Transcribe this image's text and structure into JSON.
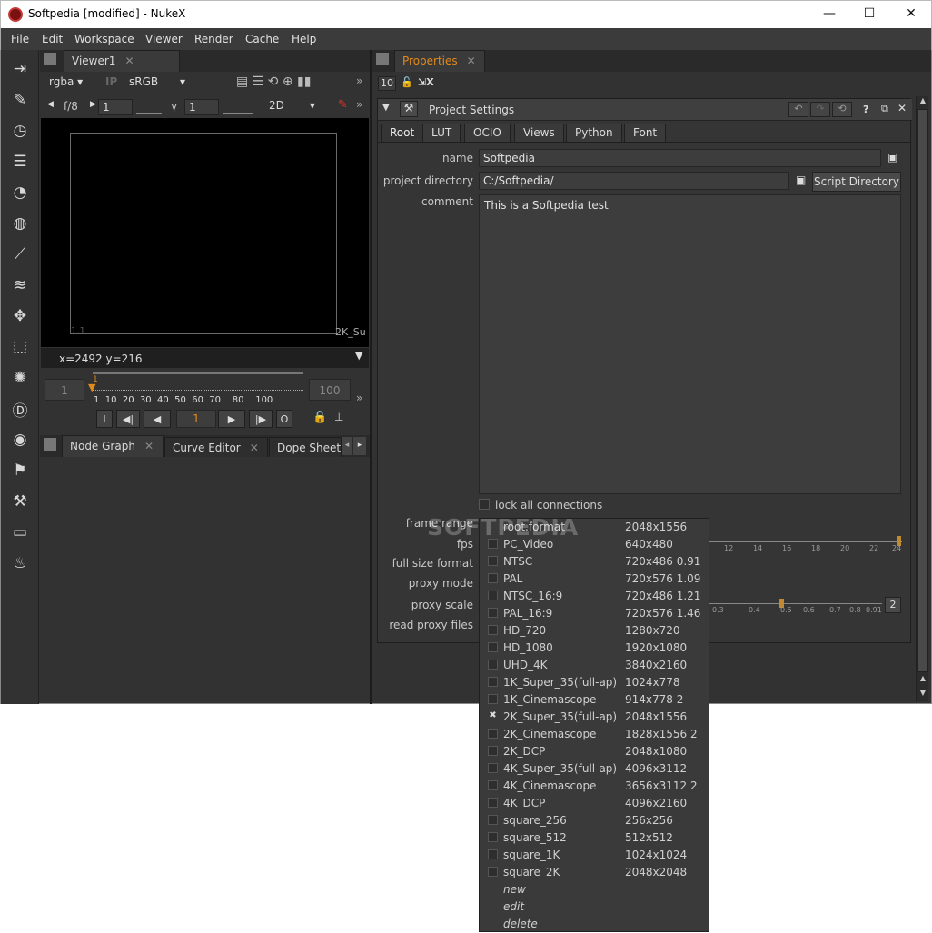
{
  "window": {
    "title": "Softpedia [modified] - NukeX",
    "min": "—",
    "max": "☐",
    "close": "✕"
  },
  "menu": [
    "File",
    "Edit",
    "Workspace",
    "Viewer",
    "Render",
    "Cache",
    "Help"
  ],
  "viewer": {
    "tab": "Viewer1",
    "channels": "rgba",
    "ip": "IP",
    "lut": "sRGB",
    "fstop": "f/8",
    "gain": "1",
    "gamma_label": "γ",
    "gamma": "1",
    "mode": "2D",
    "corner_bl": "1,1",
    "corner_br": "2K_Su",
    "coords": "x=2492 y=216",
    "range_start": "1",
    "range_end": "100",
    "cur_marker": "1",
    "ticks": [
      "1",
      "10",
      "20",
      "30",
      "40",
      "50",
      "60",
      "70",
      "80",
      "100"
    ],
    "frame": "1",
    "btn_in": "I",
    "btn_out": "O"
  },
  "bottom_tabs": [
    "Node Graph",
    "Curve Editor",
    "Dope Sheet"
  ],
  "properties": {
    "tab": "Properties",
    "count": "10",
    "panel_title": "Project Settings",
    "tabs": [
      "Root",
      "LUT",
      "OCIO",
      "Views",
      "Python",
      "Font"
    ],
    "name_label": "name",
    "name_value": "Softpedia",
    "dir_label": "project directory",
    "dir_value": "C:/Softpedia/",
    "script_dir_btn": "Script Directory",
    "comment_label": "comment",
    "comment_value": "This is a Softpedia test",
    "lock_label": "lock all connections",
    "labels": [
      "frame range",
      "fps",
      "full size format",
      "proxy mode",
      "proxy scale",
      "read proxy files"
    ],
    "fps_ticks": [
      "12",
      "14",
      "16",
      "18",
      "20",
      "22",
      "24"
    ],
    "scale_ticks": [
      "0.3",
      "0.4",
      "0.5",
      "0.6",
      "0.7",
      "0.8",
      "0.91"
    ],
    "scale_value": "2"
  },
  "watermark": "SOFTPEDIA",
  "dropdown": {
    "items": [
      {
        "name": "root.format",
        "dim": "2048x1556",
        "checked": false,
        "nocb": true
      },
      {
        "name": "PC_Video",
        "dim": "640x480",
        "checked": false
      },
      {
        "name": "NTSC",
        "dim": "720x486 0.91",
        "checked": false
      },
      {
        "name": "PAL",
        "dim": "720x576 1.09",
        "checked": false
      },
      {
        "name": "NTSC_16:9",
        "dim": "720x486 1.21",
        "checked": false
      },
      {
        "name": "PAL_16:9",
        "dim": "720x576 1.46",
        "checked": false
      },
      {
        "name": "HD_720",
        "dim": "1280x720",
        "checked": false
      },
      {
        "name": "HD_1080",
        "dim": "1920x1080",
        "checked": false
      },
      {
        "name": "UHD_4K",
        "dim": "3840x2160",
        "checked": false
      },
      {
        "name": "1K_Super_35(full-ap)",
        "dim": "1024x778",
        "checked": false
      },
      {
        "name": "1K_Cinemascope",
        "dim": "914x778 2",
        "checked": false
      },
      {
        "name": "2K_Super_35(full-ap)",
        "dim": "2048x1556",
        "checked": true
      },
      {
        "name": "2K_Cinemascope",
        "dim": "1828x1556 2",
        "checked": false
      },
      {
        "name": "2K_DCP",
        "dim": "2048x1080",
        "checked": false
      },
      {
        "name": "4K_Super_35(full-ap)",
        "dim": "4096x3112",
        "checked": false
      },
      {
        "name": "4K_Cinemascope",
        "dim": "3656x3112 2",
        "checked": false
      },
      {
        "name": "4K_DCP",
        "dim": "4096x2160",
        "checked": false
      },
      {
        "name": "square_256",
        "dim": "256x256",
        "checked": false
      },
      {
        "name": "square_512",
        "dim": "512x512",
        "checked": false
      },
      {
        "name": "square_1K",
        "dim": "1024x1024",
        "checked": false
      },
      {
        "name": "square_2K",
        "dim": "2048x2048",
        "checked": false
      }
    ],
    "actions": [
      "new",
      "edit",
      "delete"
    ]
  }
}
